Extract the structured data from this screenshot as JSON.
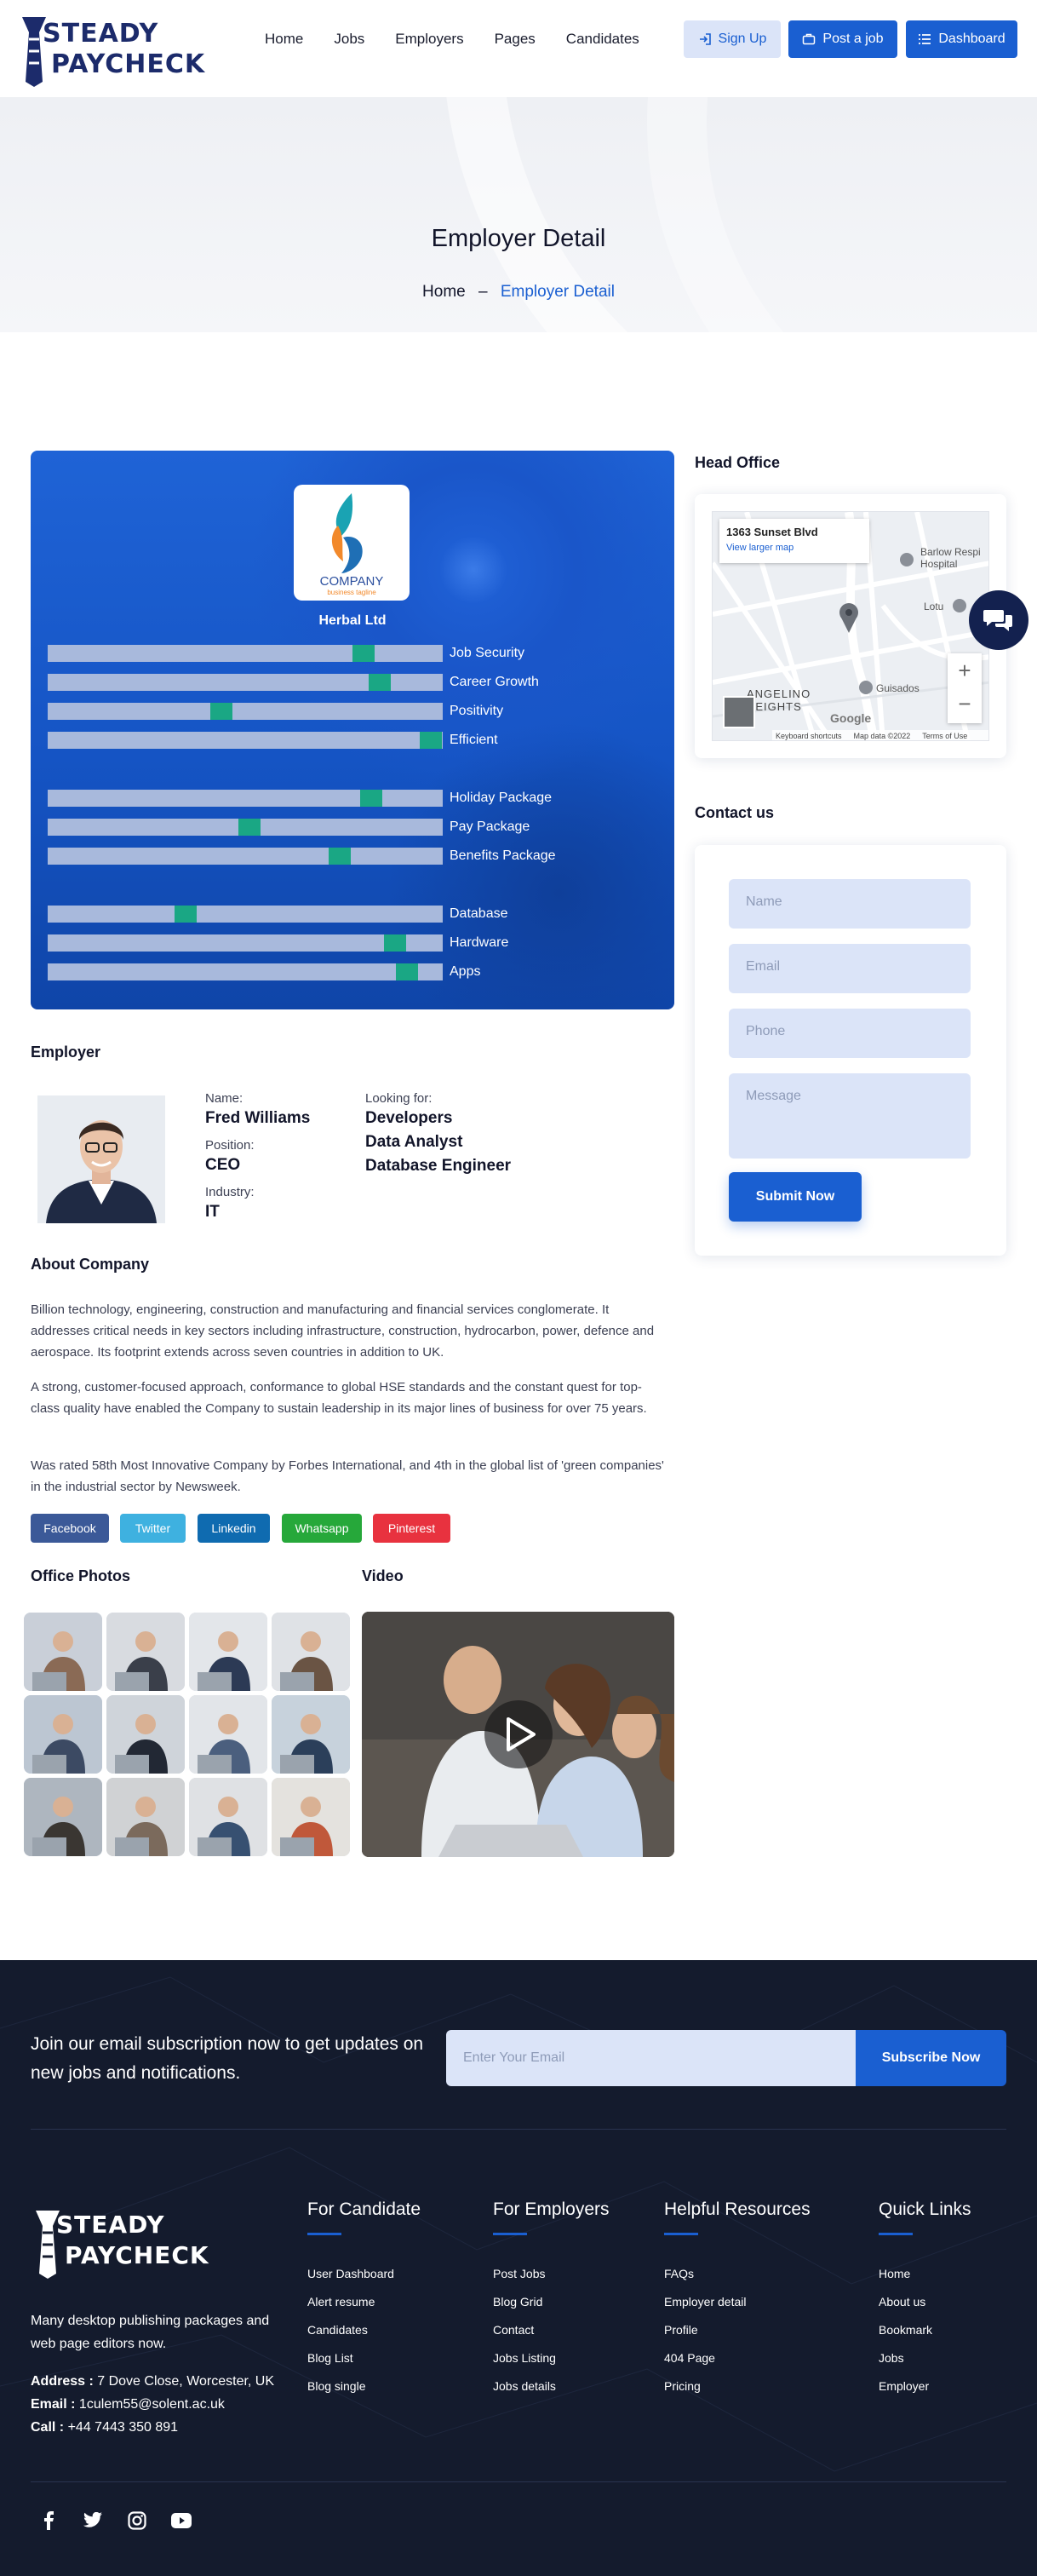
{
  "brand": {
    "line1": "STEADY",
    "line2": "PAYCHECK"
  },
  "nav": {
    "items": [
      "Home",
      "Jobs",
      "Employers",
      "Pages",
      "Candidates"
    ]
  },
  "header_buttons": {
    "signup": "Sign Up",
    "post": "Post a job",
    "dashboard": "Dashboard"
  },
  "banner": {
    "title": "Employer Detail",
    "crumb_home": "Home",
    "crumb_sep": "–",
    "crumb_current": "Employer Detail"
  },
  "company": {
    "logo_text": "COMPANY",
    "logo_tagline": "business tagline",
    "name": "Herbal Ltd",
    "ratings": [
      {
        "label": "Job Security",
        "value": 0.8
      },
      {
        "label": "Career Growth",
        "value": 0.84
      },
      {
        "label": "Positivity",
        "value": 0.44
      },
      {
        "label": "Efficient",
        "value": 0.97
      },
      {
        "label": "Holiday Package",
        "value": 0.82
      },
      {
        "label": "Pay Package",
        "value": 0.51
      },
      {
        "label": "Benefits Package",
        "value": 0.74
      },
      {
        "label": "Database",
        "value": 0.35
      },
      {
        "label": "Hardware",
        "value": 0.88
      },
      {
        "label": "Apps",
        "value": 0.91
      }
    ]
  },
  "head_office": {
    "title": "Head Office",
    "map_address": "1363 Sunset Blvd",
    "map_link": "View larger map",
    "map_labels": [
      "Barlow Respi Hospital",
      "Lotu",
      "ANGELINO HEIGHTS",
      "Guisados"
    ],
    "map_footer": [
      "Keyboard shortcuts",
      "Map data ©2022",
      "Terms of Use"
    ],
    "map_brand": "Google"
  },
  "contact": {
    "title": "Contact us",
    "name_ph": "Name",
    "email_ph": "Email",
    "phone_ph": "Phone",
    "message_ph": "Message",
    "submit": "Submit Now"
  },
  "employer": {
    "title": "Employer",
    "name_label": "Name:",
    "name": "Fred Williams",
    "position_label": "Position:",
    "position": "CEO",
    "industry_label": "Industry:",
    "industry": "IT",
    "looking_label": "Looking for:",
    "looking": [
      "Developers",
      "Data Analyst",
      "Database Engineer"
    ]
  },
  "about": {
    "title": "About Company",
    "p1": "Billion technology, engineering, construction and manufacturing and financial services conglomerate. It addresses critical needs in key sectors including infrastructure, construction, hydrocarbon, power, defence and aerospace. Its footprint extends across seven countries in addition to UK.",
    "p2": "A strong, customer-focused approach, conformance to global HSE standards and the constant quest for top-class quality have enabled the Company to sustain leadership in its major lines of business for over 75 years.",
    "p3": "Was rated 58th Most Innovative Company by Forbes International, and 4th in the global list of 'green companies' in the industrial sector by Newsweek."
  },
  "social": [
    {
      "label": "Facebook",
      "color": "#3b5998"
    },
    {
      "label": "Twitter",
      "color": "#3eb1e0"
    },
    {
      "label": "Linkedin",
      "color": "#0f6bb0"
    },
    {
      "label": "Whatsapp",
      "color": "#26a83a"
    },
    {
      "label": "Pinterest",
      "color": "#e8323f"
    }
  ],
  "media": {
    "photos_title": "Office Photos",
    "video_title": "Video"
  },
  "footer": {
    "sub_text": "Join our email subscription now to get updates on new jobs and notifications.",
    "sub_placeholder": "Enter Your Email",
    "sub_button": "Subscribe Now",
    "desc": "Many desktop publishing packages and web page editors now.",
    "address_label": "Address :",
    "address": "7 Dove Close, Worcester, UK",
    "email_label": "Email :",
    "email": "1culem55@solent.ac.uk",
    "call_label": "Call :",
    "call": "+44 7443 350 891",
    "cols": [
      {
        "title": "For Candidate",
        "links": [
          "User Dashboard",
          "Alert resume",
          "Candidates",
          "Blog List",
          "Blog single"
        ]
      },
      {
        "title": "For Employers",
        "links": [
          "Post Jobs",
          "Blog Grid",
          "Contact",
          "Jobs Listing",
          "Jobs details"
        ]
      },
      {
        "title": "Helpful Resources",
        "links": [
          "FAQs",
          "Employer detail",
          "Profile",
          "404 Page",
          "Pricing"
        ]
      },
      {
        "title": "Quick Links",
        "links": [
          "Home",
          "About us",
          "Bookmark",
          "Jobs",
          "Employer"
        ]
      }
    ]
  },
  "colors": {
    "primary": "#1a5fd1",
    "marker": "#1aa784",
    "footer_bg": "#141b2d",
    "navy": "#1c2b6b"
  }
}
